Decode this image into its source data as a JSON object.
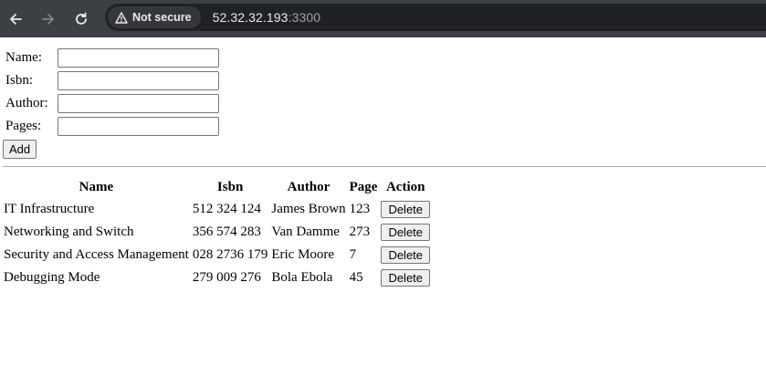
{
  "browser": {
    "security_label": "Not secure",
    "url_host": "52.32.32.193",
    "url_port": ":3300"
  },
  "form": {
    "name_label": "Name:",
    "isbn_label": "Isbn:",
    "author_label": "Author:",
    "pages_label": "Pages:",
    "name_value": "",
    "isbn_value": "",
    "author_value": "",
    "pages_value": "",
    "add_label": "Add"
  },
  "table": {
    "headers": [
      "Name",
      "Isbn",
      "Author",
      "Page",
      "Action"
    ],
    "rows": [
      {
        "name": "IT Infrastructure",
        "isbn": "512 324 124",
        "author": "James Brown",
        "page": "123",
        "action": "Delete"
      },
      {
        "name": "Networking and Switch",
        "isbn": "356 574 283",
        "author": "Van Damme",
        "page": "273",
        "action": "Delete"
      },
      {
        "name": "Security and Access Management",
        "isbn": "028 2736 179",
        "author": "Eric Moore",
        "page": "7",
        "action": "Delete"
      },
      {
        "name": "Debugging Mode",
        "isbn": "279 009 276",
        "author": "Bola Ebola",
        "page": "45",
        "action": "Delete"
      }
    ]
  }
}
